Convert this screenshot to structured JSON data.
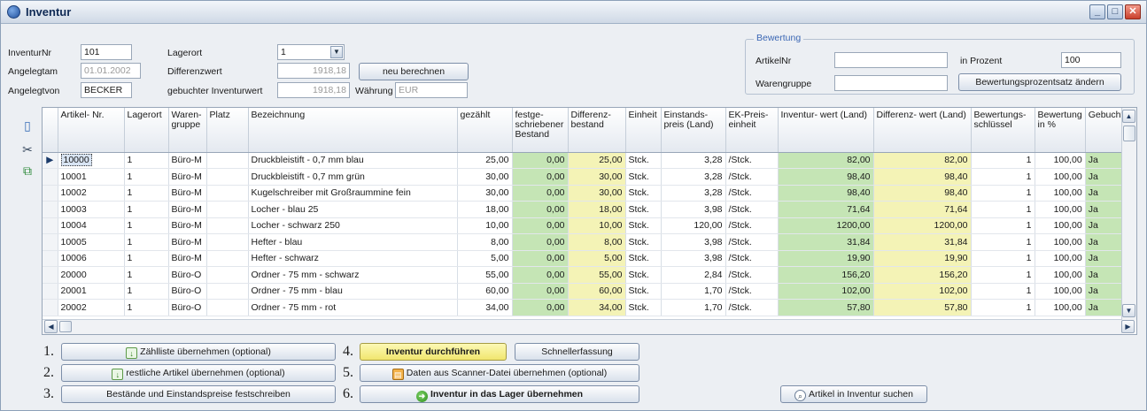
{
  "window": {
    "title": "Inventur",
    "controls": {
      "minimize": "_",
      "maximize": "□",
      "close": "✕"
    }
  },
  "header": {
    "inventurnr_label": "InventurNr",
    "inventurnr_value": "101",
    "angelegtam_label": "Angelegtam",
    "angelegtam_value": "01.01.2002",
    "angelegtvon_label": "Angelegtvon",
    "angelegtvon_value": "BECKER",
    "lagerort_label": "Lagerort",
    "lagerort_value": "1",
    "differenzwert_label": "Differenzwert",
    "differenzwert_value": "1918,18",
    "gebuchter_label": "gebuchter Inventurwert",
    "gebuchter_value": "1918,18",
    "neu_berechnen": "neu berechnen",
    "waehrung_label": "Währung",
    "waehrung_value": "EUR"
  },
  "bewertung": {
    "title": "Bewertung",
    "artikelnr_label": "ArtikelNr",
    "artikelnr_value": "",
    "warengruppe_label": "Warengruppe",
    "warengruppe_value": "",
    "prozent_label": "in Prozent",
    "prozent_value": "100",
    "aendern_button": "Bewertungsprozentsatz ändern"
  },
  "toolbar_icons": [
    "new-document-icon",
    "cut-scissors-icon",
    "copy-items-icon"
  ],
  "grid": {
    "columns": [
      {
        "key": "artnr",
        "label": "Artikel- Nr."
      },
      {
        "key": "lager",
        "label": "Lagerort"
      },
      {
        "key": "wg",
        "label": "Waren- gruppe"
      },
      {
        "key": "platz",
        "label": "Platz"
      },
      {
        "key": "bez",
        "label": "Bezeichnung"
      },
      {
        "key": "gezaehlt",
        "label": "gezählt"
      },
      {
        "key": "fest",
        "label": "festge- schriebener Bestand"
      },
      {
        "key": "diffb",
        "label": "Differenz- bestand"
      },
      {
        "key": "einheit",
        "label": "Einheit"
      },
      {
        "key": "ekpreis",
        "label": "Einstands- preis (Land)"
      },
      {
        "key": "ekeinheit",
        "label": "EK-Preis- einheit"
      },
      {
        "key": "invwert",
        "label": "Inventur- wert (Land)"
      },
      {
        "key": "diffwert",
        "label": "Differenz- wert (Land)"
      },
      {
        "key": "bschl",
        "label": "Bewertungs- schlüssel"
      },
      {
        "key": "bproz",
        "label": "Bewertung in %"
      },
      {
        "key": "gebucht",
        "label": "Gebucht"
      }
    ],
    "rows": [
      {
        "artnr": "10000",
        "lager": "1",
        "wg": "Büro-M",
        "platz": "",
        "bez": "Druckbleistift - 0,7 mm  blau",
        "gezaehlt": "25,00",
        "fest": "0,00",
        "diffb": "25,00",
        "einheit": "Stck.",
        "ekpreis": "3,28",
        "ekeinheit": "/Stck.",
        "invwert": "82,00",
        "diffwert": "82,00",
        "bschl": "1",
        "bproz": "100,00",
        "gebucht": "Ja"
      },
      {
        "artnr": "10001",
        "lager": "1",
        "wg": "Büro-M",
        "platz": "",
        "bez": "Druckbleistift - 0,7 mm  grün",
        "gezaehlt": "30,00",
        "fest": "0,00",
        "diffb": "30,00",
        "einheit": "Stck.",
        "ekpreis": "3,28",
        "ekeinheit": "/Stck.",
        "invwert": "98,40",
        "diffwert": "98,40",
        "bschl": "1",
        "bproz": "100,00",
        "gebucht": "Ja"
      },
      {
        "artnr": "10002",
        "lager": "1",
        "wg": "Büro-M",
        "platz": "",
        "bez": "Kugelschreiber mit Großraummine fein",
        "gezaehlt": "30,00",
        "fest": "0,00",
        "diffb": "30,00",
        "einheit": "Stck.",
        "ekpreis": "3,28",
        "ekeinheit": "/Stck.",
        "invwert": "98,40",
        "diffwert": "98,40",
        "bschl": "1",
        "bproz": "100,00",
        "gebucht": "Ja"
      },
      {
        "artnr": "10003",
        "lager": "1",
        "wg": "Büro-M",
        "platz": "",
        "bez": "Locher - blau 25",
        "gezaehlt": "18,00",
        "fest": "0,00",
        "diffb": "18,00",
        "einheit": "Stck.",
        "ekpreis": "3,98",
        "ekeinheit": "/Stck.",
        "invwert": "71,64",
        "diffwert": "71,64",
        "bschl": "1",
        "bproz": "100,00",
        "gebucht": "Ja"
      },
      {
        "artnr": "10004",
        "lager": "1",
        "wg": "Büro-M",
        "platz": "",
        "bez": "Locher - schwarz 250",
        "gezaehlt": "10,00",
        "fest": "0,00",
        "diffb": "10,00",
        "einheit": "Stck.",
        "ekpreis": "120,00",
        "ekeinheit": "/Stck.",
        "invwert": "1200,00",
        "diffwert": "1200,00",
        "bschl": "1",
        "bproz": "100,00",
        "gebucht": "Ja"
      },
      {
        "artnr": "10005",
        "lager": "1",
        "wg": "Büro-M",
        "platz": "",
        "bez": "Hefter - blau",
        "gezaehlt": "8,00",
        "fest": "0,00",
        "diffb": "8,00",
        "einheit": "Stck.",
        "ekpreis": "3,98",
        "ekeinheit": "/Stck.",
        "invwert": "31,84",
        "diffwert": "31,84",
        "bschl": "1",
        "bproz": "100,00",
        "gebucht": "Ja"
      },
      {
        "artnr": "10006",
        "lager": "1",
        "wg": "Büro-M",
        "platz": "",
        "bez": "Hefter - schwarz",
        "gezaehlt": "5,00",
        "fest": "0,00",
        "diffb": "5,00",
        "einheit": "Stck.",
        "ekpreis": "3,98",
        "ekeinheit": "/Stck.",
        "invwert": "19,90",
        "diffwert": "19,90",
        "bschl": "1",
        "bproz": "100,00",
        "gebucht": "Ja"
      },
      {
        "artnr": "20000",
        "lager": "1",
        "wg": "Büro-O",
        "platz": "",
        "bez": "Ordner - 75 mm - schwarz",
        "gezaehlt": "55,00",
        "fest": "0,00",
        "diffb": "55,00",
        "einheit": "Stck.",
        "ekpreis": "2,84",
        "ekeinheit": "/Stck.",
        "invwert": "156,20",
        "diffwert": "156,20",
        "bschl": "1",
        "bproz": "100,00",
        "gebucht": "Ja"
      },
      {
        "artnr": "20001",
        "lager": "1",
        "wg": "Büro-O",
        "platz": "",
        "bez": "Ordner - 75 mm - blau",
        "gezaehlt": "60,00",
        "fest": "0,00",
        "diffb": "60,00",
        "einheit": "Stck.",
        "ekpreis": "1,70",
        "ekeinheit": "/Stck.",
        "invwert": "102,00",
        "diffwert": "102,00",
        "bschl": "1",
        "bproz": "100,00",
        "gebucht": "Ja"
      },
      {
        "artnr": "20002",
        "lager": "1",
        "wg": "Büro-O",
        "platz": "",
        "bez": "Ordner - 75 mm - rot",
        "gezaehlt": "34,00",
        "fest": "0,00",
        "diffb": "34,00",
        "einheit": "Stck.",
        "ekpreis": "1,70",
        "ekeinheit": "/Stck.",
        "invwert": "57,80",
        "diffwert": "57,80",
        "bschl": "1",
        "bproz": "100,00",
        "gebucht": "Ja"
      }
    ]
  },
  "steps": [
    {
      "num": "1.",
      "label": "Zählliste übernehmen (optional)",
      "icon": "import-document-icon"
    },
    {
      "num": "2.",
      "label": "restliche Artikel übernehmen (optional)",
      "icon": "import-document-icon"
    },
    {
      "num": "3.",
      "label": "Bestände und Einstandspreise festschreiben",
      "icon": ""
    },
    {
      "num": "4.",
      "label": "Inventur durchführen",
      "icon": ""
    },
    {
      "num": "5.",
      "label": "Daten aus Scanner-Datei übernehmen (optional)",
      "icon": "scanner-icon"
    },
    {
      "num": "6.",
      "label": "Inventur in das Lager übernehmen",
      "icon": "go-arrow-icon"
    }
  ],
  "schnellerfassung": "Schnellerfassung",
  "suchen_button": "Artikel in Inventur suchen",
  "colors": {
    "green_cell": "#c5e5b5",
    "yellow_cell": "#f4f3b6",
    "title_accent": "#3b67b4"
  }
}
